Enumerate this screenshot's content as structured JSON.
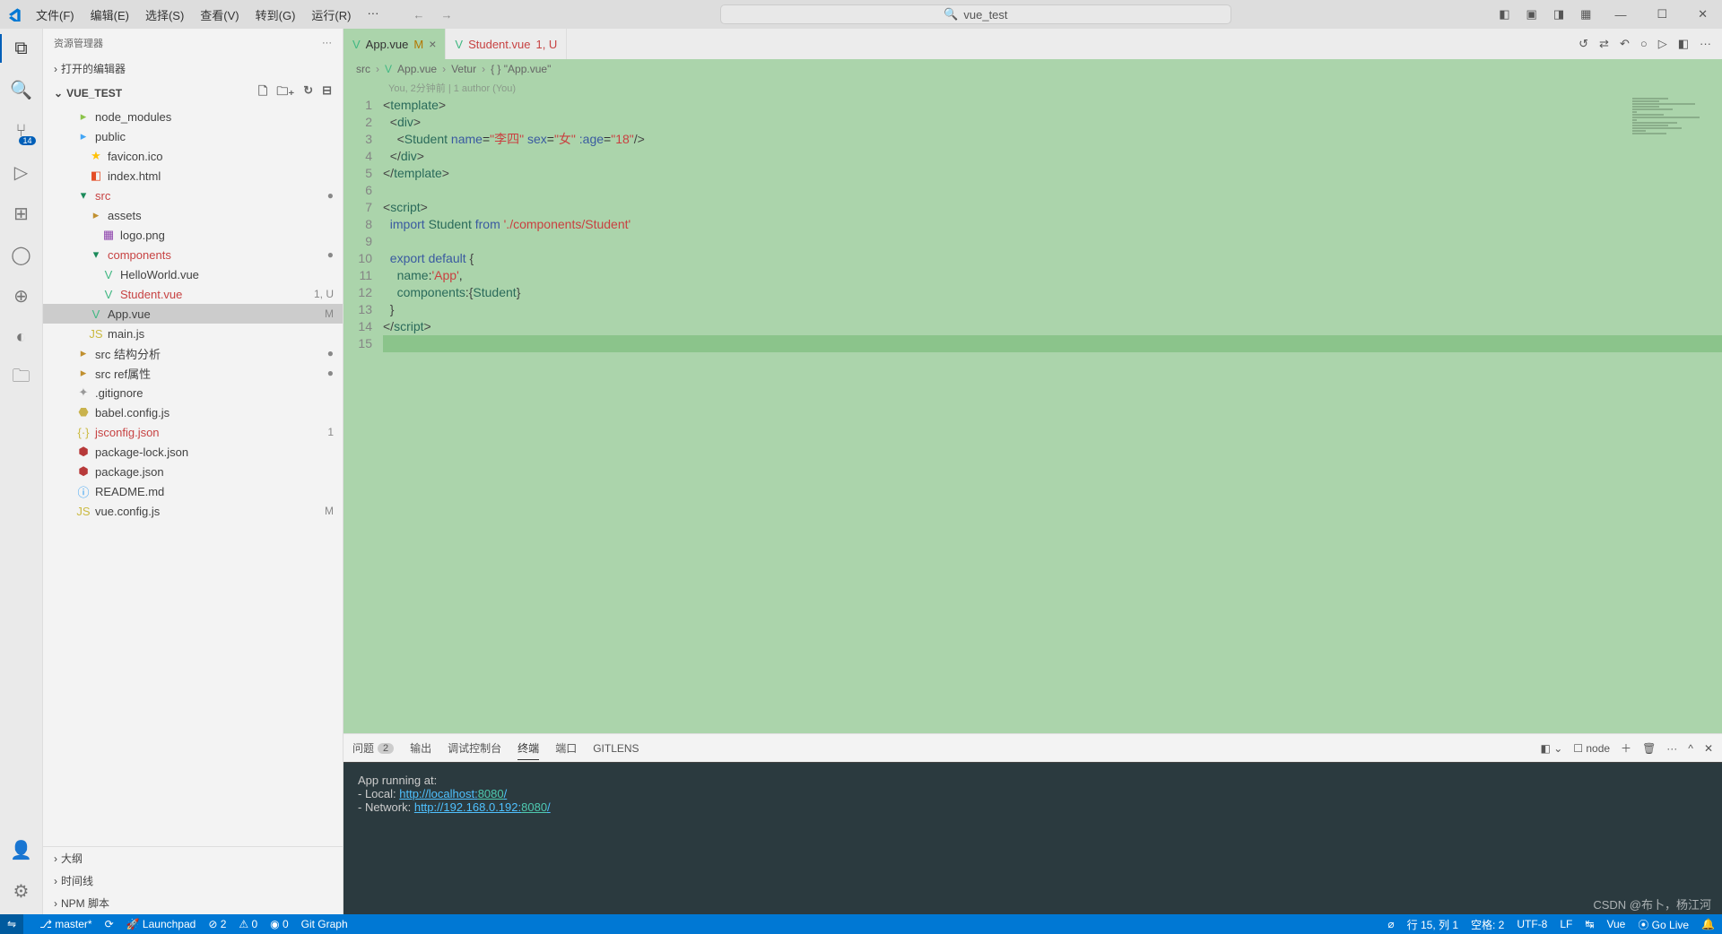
{
  "title_bar": {
    "search": "vue_test"
  },
  "menu": {
    "file": "文件(F)",
    "edit": "编辑(E)",
    "select": "选择(S)",
    "view": "查看(V)",
    "go": "转到(G)",
    "run": "运行(R)",
    "more": "···"
  },
  "activity": {
    "scm_badge": "14"
  },
  "sidebar": {
    "title": "资源管理器",
    "more": "···",
    "open_editors": "打开的编辑器",
    "project": "VUE_TEST",
    "outline": "大纲",
    "timeline": "时间线",
    "npm": "NPM 脚本",
    "tree": [
      {
        "pad": 2,
        "icon": "ic-node",
        "glyph": "▸",
        "label": "node_modules"
      },
      {
        "pad": 2,
        "icon": "ic-pub",
        "glyph": "▸",
        "label": "public"
      },
      {
        "pad": 3,
        "icon": "ic-star",
        "glyph": "★",
        "label": "favicon.ico"
      },
      {
        "pad": 3,
        "icon": "ic-html",
        "glyph": "◧",
        "label": "index.html"
      },
      {
        "pad": 2,
        "icon": "folder-green",
        "glyph": "▾",
        "label": "src",
        "badge": "●",
        "badgeCls": "dot-green",
        "labelCls": "file-red"
      },
      {
        "pad": 3,
        "icon": "folder-yellow-i",
        "glyph": "▸",
        "label": "assets"
      },
      {
        "pad": 4,
        "icon": "ic-img",
        "glyph": "▦",
        "label": "logo.png"
      },
      {
        "pad": 3,
        "icon": "folder-green",
        "glyph": "▾",
        "label": "components",
        "badge": "●",
        "badgeCls": "dot-green",
        "labelCls": "file-red"
      },
      {
        "pad": 4,
        "icon": "ic-vue",
        "glyph": "V",
        "label": "HelloWorld.vue"
      },
      {
        "pad": 4,
        "icon": "ic-vue",
        "glyph": "V",
        "label": "Student.vue",
        "badge": "1, U",
        "labelCls": "file-red",
        "badgeCls": "file-red"
      },
      {
        "pad": 3,
        "icon": "ic-vue",
        "glyph": "V",
        "label": "App.vue",
        "badge": "M",
        "selected": true,
        "badgeCls": "file-mod"
      },
      {
        "pad": 3,
        "icon": "ic-js",
        "glyph": "JS",
        "label": "main.js"
      },
      {
        "pad": 2,
        "icon": "folder-yellow-i",
        "glyph": "▸",
        "label": "src 结构分析",
        "badge": "●",
        "badgeCls": "dot-green"
      },
      {
        "pad": 2,
        "icon": "folder-yellow-i",
        "glyph": "▸",
        "label": "src ref属性",
        "badge": "●",
        "badgeCls": "dot-green"
      },
      {
        "pad": 2,
        "icon": "ic-git",
        "glyph": "✦",
        "label": ".gitignore"
      },
      {
        "pad": 2,
        "icon": "ic-babel",
        "glyph": "⬣",
        "label": "babel.config.js"
      },
      {
        "pad": 2,
        "icon": "ic-json-b",
        "glyph": "{·}",
        "label": "jsconfig.json",
        "badge": "1",
        "labelCls": "file-red",
        "badgeCls": "file-red"
      },
      {
        "pad": 2,
        "icon": "ic-lock",
        "glyph": "⬢",
        "label": "package-lock.json"
      },
      {
        "pad": 2,
        "icon": "ic-lock",
        "glyph": "⬢",
        "label": "package.json"
      },
      {
        "pad": 2,
        "icon": "ic-info",
        "glyph": "ⓘ",
        "label": "README.md"
      },
      {
        "pad": 2,
        "icon": "ic-js",
        "glyph": "JS",
        "label": "vue.config.js",
        "badge": "M",
        "badgeCls": "file-mod"
      }
    ]
  },
  "tabs": {
    "items": [
      {
        "label": "App.vue",
        "status": "M",
        "statusCls": "file-mod",
        "active": true,
        "close": "×"
      },
      {
        "label": "Student.vue",
        "status": "1, U",
        "statusCls": "file-red",
        "labelCls": "file-red"
      }
    ]
  },
  "breadcrumb": [
    "src",
    "App.vue",
    "Vetur",
    "{ } \"App.vue\""
  ],
  "blame": "You, 2分钟前 | 1 author (You)",
  "code": {
    "lines": [
      {
        "n": 1,
        "html": "<span class='tok-punct'>&lt;</span><span class='tok-tag'>template</span><span class='tok-punct'>&gt;</span>"
      },
      {
        "n": 2,
        "html": "  <span class='tok-punct'>&lt;</span><span class='tok-tag'>div</span><span class='tok-punct'>&gt;</span>"
      },
      {
        "n": 3,
        "html": "    <span class='tok-punct'>&lt;</span><span class='tok-tag'>Student</span> <span class='tok-attr'>name</span>=<span class='tok-str'>\"李四\"</span> <span class='tok-attr'>sex</span>=<span class='tok-str'>\"女\"</span> <span class='tok-attr'>:age</span>=<span class='tok-str'>\"</span><span class='tok-num'>18</span><span class='tok-str'>\"</span><span class='tok-punct'>/&gt;</span>"
      },
      {
        "n": 4,
        "html": "  <span class='tok-punct'>&lt;/</span><span class='tok-tag'>div</span><span class='tok-punct'>&gt;</span>"
      },
      {
        "n": 5,
        "html": "<span class='tok-punct'>&lt;/</span><span class='tok-tag'>template</span><span class='tok-punct'>&gt;</span>"
      },
      {
        "n": 6,
        "html": ""
      },
      {
        "n": 7,
        "html": "<span class='tok-punct'>&lt;</span><span class='tok-tag'>script</span><span class='tok-punct'>&gt;</span>"
      },
      {
        "n": 8,
        "html": "  <span class='tok-kw'>import</span> <span class='tok-name'>Student</span> <span class='tok-kw'>from</span> <span class='tok-str'>'./components/Student'</span>"
      },
      {
        "n": 9,
        "html": ""
      },
      {
        "n": 10,
        "html": "  <span class='tok-kw'>export</span> <span class='tok-kw'>default</span> <span class='tok-punct'>{</span>"
      },
      {
        "n": 11,
        "html": "    <span class='tok-name'>name</span>:<span class='tok-str'>'App'</span>,"
      },
      {
        "n": 12,
        "html": "    <span class='tok-name'>components</span>:<span class='tok-punct'>{</span><span class='tok-name'>Student</span><span class='tok-punct'>}</span>"
      },
      {
        "n": 13,
        "html": "  <span class='tok-punct'>}</span>"
      },
      {
        "n": 14,
        "html": "<span class='tok-punct'>&lt;/</span><span class='tok-tag'>script</span><span class='tok-punct'>&gt;</span>"
      },
      {
        "n": 15,
        "html": "",
        "current": true
      }
    ]
  },
  "panel": {
    "tabs": {
      "problems": "问题",
      "problems_count": "2",
      "output": "输出",
      "debug": "调试控制台",
      "terminal": "终端",
      "ports": "端口",
      "gitlens": "GITLENS"
    },
    "right_node": "node",
    "terminal": {
      "l1": "App running at:",
      "l2_label": "- Local:   ",
      "l2_url": "http://localhost:",
      "l2_port": "8080",
      "l2_end": "/",
      "l3_label": "- Network: ",
      "l3_url": "http://192.168.0.192:",
      "l3_port": "8080",
      "l3_end": "/"
    }
  },
  "status": {
    "branch": "master*",
    "sync": "⟳",
    "launchpad": "Launchpad",
    "errors": "⊘ 2",
    "warnings": "⚠ 0",
    "radio": "◉ 0",
    "gitgraph": "Git Graph",
    "notif": "⌀",
    "pos": "行 15, 列 1",
    "spaces": "空格: 2",
    "enc": "UTF-8",
    "eol": "LF",
    "lang": "Vue",
    "golive": "⦿ Go Live",
    "bell": "🔔"
  },
  "watermark": "CSDN @布卜，杨江河"
}
